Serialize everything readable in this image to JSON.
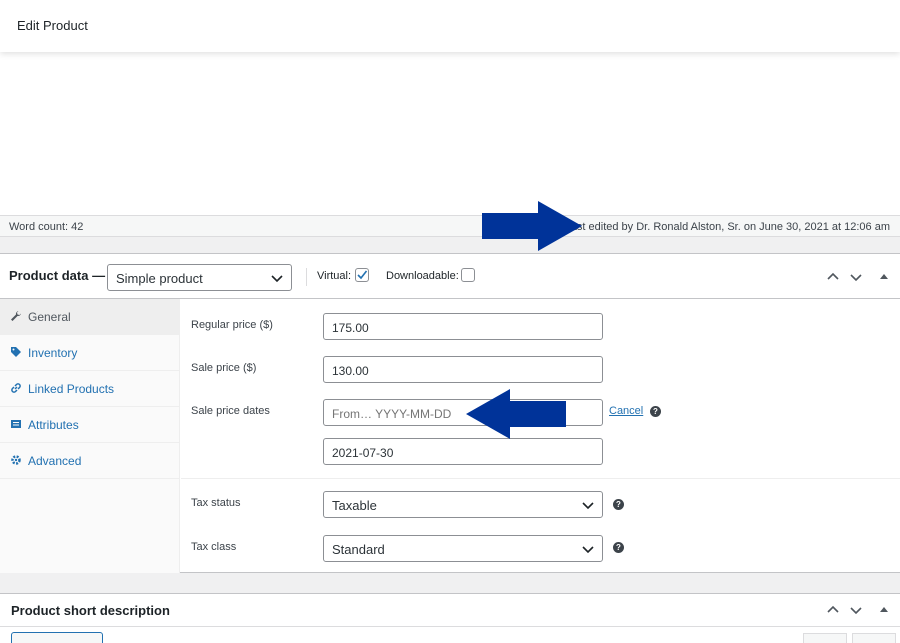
{
  "header": {
    "title": "Edit Product"
  },
  "status_bar": {
    "word_count": "Word count: 42",
    "last_edited": "Last edited by Dr. Ronald Alston, Sr. on June 30, 2021 at 12:06 am"
  },
  "product_data": {
    "title": "Product data —",
    "type_select": "Simple product",
    "virtual_label": "Virtual:",
    "virtual_checked": true,
    "downloadable_label": "Downloadable:",
    "downloadable_checked": false
  },
  "tabs": [
    {
      "label": "General",
      "icon": "wrench-icon",
      "active": true
    },
    {
      "label": "Inventory",
      "icon": "tag-icon",
      "active": false
    },
    {
      "label": "Linked Products",
      "icon": "link-icon",
      "active": false
    },
    {
      "label": "Attributes",
      "icon": "list-icon",
      "active": false
    },
    {
      "label": "Advanced",
      "icon": "gear-icon",
      "active": false
    }
  ],
  "general": {
    "regular_price_label": "Regular price ($)",
    "regular_price": "175.00",
    "sale_price_label": "Sale price ($)",
    "sale_price": "130.00",
    "sale_dates_label": "Sale price dates",
    "sale_from_placeholder": "From… YYYY-MM-DD",
    "sale_to": "2021-07-30",
    "cancel": "Cancel",
    "tax_status_label": "Tax status",
    "tax_status": "Taxable",
    "tax_class_label": "Tax class",
    "tax_class": "Standard"
  },
  "short_description": {
    "title": "Product short description"
  },
  "colors": {
    "accent": "#2271b1",
    "arrow": "#003399"
  }
}
